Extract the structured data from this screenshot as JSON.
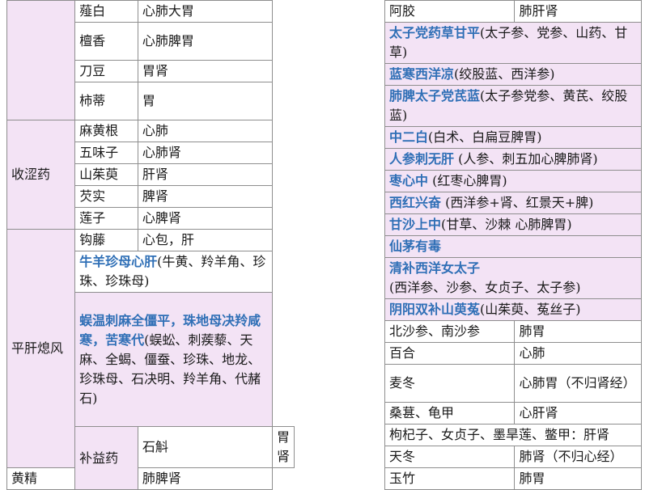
{
  "colors": {
    "pink": "#f3e3f5",
    "blue_text": "#2f6fb6",
    "border": "#8e8e8e"
  },
  "left": {
    "rows": [
      {
        "herb": "薤白",
        "meridian": "心肺大胃"
      },
      {
        "herb": "檀香",
        "meridian": "心肺脾胃"
      },
      {
        "herb": "刀豆",
        "meridian": "胃肾"
      },
      {
        "herb": "柿蒂",
        "meridian": "胃"
      }
    ],
    "astringent": {
      "category": "收涩药",
      "rows": [
        {
          "herb": "麻黄根",
          "meridian": "心肺"
        },
        {
          "herb": "五味子",
          "meridian": "心肺肾"
        },
        {
          "herb": "山茱萸",
          "meridian": "肝肾"
        },
        {
          "herb": "芡实",
          "meridian": "脾肾"
        },
        {
          "herb": "莲子",
          "meridian": "心脾肾"
        }
      ]
    },
    "calm_liver": {
      "category": "平肝熄风",
      "row1": {
        "herb": "钩藤",
        "meridian": "心包，肝"
      },
      "mnemonic1": {
        "bold": "牛羊珍母心肝",
        "normal": "(牛黄、羚羊角、珍珠、珍珠母)"
      },
      "mnemonic2": {
        "bold": "蜈温刺麻全僵平，珠地母决羚咸寒，苦寒代",
        "normal": "(蜈蚣、刺蒺藜、天麻、全蝎、僵蚕、珍珠、地龙、珍珠母、石决明、羚羊角、代赭石)"
      }
    },
    "tonic": {
      "category": "补益药",
      "rows": [
        {
          "herb": "石斛",
          "meridian": "胃肾"
        },
        {
          "herb": "黄精",
          "meridian": "肺脾肾"
        }
      ]
    }
  },
  "right": {
    "top": {
      "herb": "阿胶",
      "meridian": "肺肝肾"
    },
    "mnemonics": [
      {
        "bold": "太子党药草甘平",
        "normal": "(太子参、党参、山药、甘草)"
      },
      {
        "bold": "蓝寒西洋凉",
        "normal": "(绞股蓝、西洋参)"
      },
      {
        "bold": "肺脾太子党芪蓝",
        "normal": "(太子参党参、黄芪、绞股蓝)"
      },
      {
        "bold": "中二白",
        "normal": "(白术、白扁豆脾胃)"
      },
      {
        "bold": "人参刺无肝",
        "normal": " (人参、刺五加心脾肺肾)"
      },
      {
        "bold": "枣心中",
        "normal": " (红枣心脾胃)"
      },
      {
        "bold": "西红兴奋",
        "normal": " (西洋参+肾、红景天+脾)"
      },
      {
        "bold": "甘沙上中",
        "normal": "(甘草、沙棘 心肺脾胃)"
      },
      {
        "bold": "仙茅有毒",
        "normal": ""
      },
      {
        "bold": "清补西洋女太子",
        "normal": ""
      },
      {
        "bold": "",
        "normal": "(西洋参、沙参、女贞子、太子参)"
      },
      {
        "bold": "阴阳双补山萸菟",
        "normal": "(山茱萸、菟丝子)"
      }
    ],
    "rows": [
      {
        "herb": "北沙参、南沙参",
        "meridian": "肺胃"
      },
      {
        "herb": "百合",
        "meridian": "心肺"
      },
      {
        "herb": "麦冬",
        "meridian": "心肺胃（不归肾经）"
      },
      {
        "herb": "桑葚、龟甲",
        "meridian": "心肝肾"
      }
    ],
    "full_row": "枸杞子、女贞子、墨旱莲、鳖甲：肝肾",
    "bottom_rows": [
      {
        "herb": "天冬",
        "meridian": "肺肾（不归心经）"
      },
      {
        "herb": "玉竹",
        "meridian": "肺胃"
      }
    ]
  }
}
